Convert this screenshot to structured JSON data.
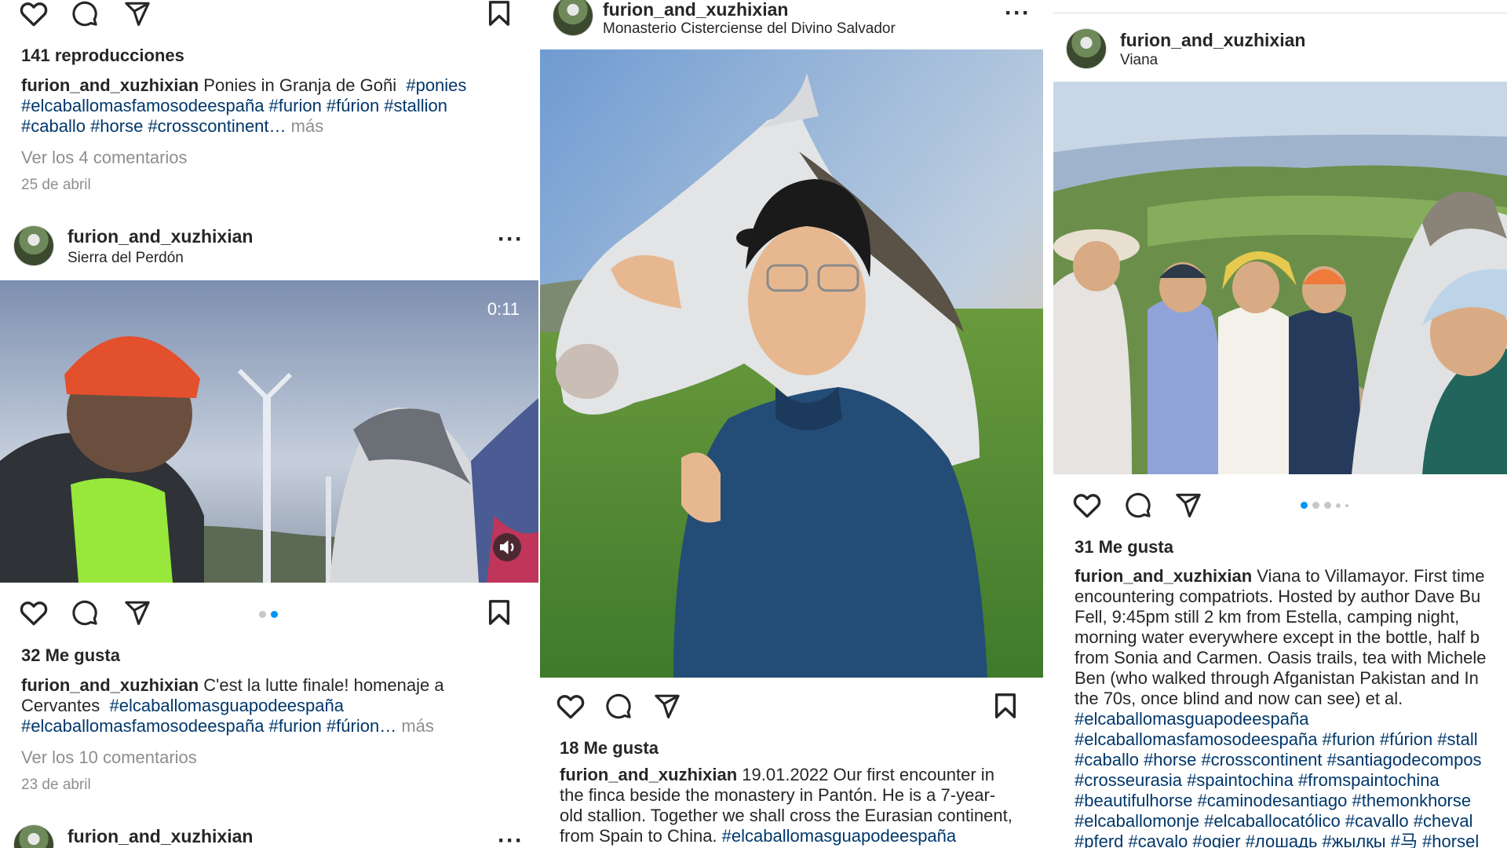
{
  "post1": {
    "views": "141 reproducciones",
    "caption_user": "furion_and_xuzhixian",
    "caption_text": "Ponies in Granja de Goñi",
    "tags_line1": "#ponies",
    "tags_line2": "#elcaballomasfamosodeespaña #furion #fúrion #stallion",
    "tags_line3": "#caballo #horse #crosscontinent…",
    "more": "más",
    "view_comments": "Ver los 4 comentarios",
    "date": "25 de abril"
  },
  "post2": {
    "username": "furion_and_xuzhixian",
    "location": "Sierra del Perdón",
    "video_time": "0:11",
    "likes": "32 Me gusta",
    "caption_user": "furion_and_xuzhixian",
    "caption_text": "C'est la lutte finale! homenaje a",
    "caption_line2_text": "Cervantes",
    "caption_line2_tag": "#elcaballomasguapodeespaña",
    "caption_line3_tags": "#elcaballomasfamosodeespaña #furion #fúrion…",
    "more": "más",
    "view_comments": "Ver los 10 comentarios",
    "date": "23 de abril"
  },
  "post3": {
    "username": "furion_and_xuzhixian"
  },
  "post4": {
    "username": "furion_and_xuzhixian",
    "location": "Monasterio Cisterciense del Divino Salvador",
    "likes": "18 Me gusta",
    "caption_user": "furion_and_xuzhixian",
    "caption_line1": "19.01.2022 Our first encounter in",
    "caption_line2": "the finca beside the monastery in Pantón. He is a 7-year-",
    "caption_line3": "old stallion. Together we shall cross the Eurasian continent,",
    "caption_line4_text": "from Spain to China.",
    "caption_line4_tag": "#elcaballomasguapodeespaña"
  },
  "post5": {
    "username": "furion_and_xuzhixian",
    "location": "Viana",
    "likes": "31 Me gusta",
    "caption_user": "furion_and_xuzhixian",
    "lines": [
      "Viana to Villamayor. First time",
      "encountering compatriots. Hosted by author Dave Bu",
      "Fell, 9:45pm still 2 km from Estella, camping night,",
      "morning water everywhere except in the bottle, half b",
      "from Sonia and Carmen. Oasis trails, tea with Michele",
      "Ben (who walked through Afganistan Pakistan and In",
      "the 70s, once blind and now can see) et al."
    ],
    "tags": [
      "#elcaballomasguapodeespaña",
      "#elcaballomasfamosodeespaña #furion #fúrion #stall",
      "#caballo #horse #crosscontinent #santiagodecompos",
      "#crosseurasia #spaintochina #fromspaintochina",
      "#beautifulhorse #caminodesantiago #themonkhorse",
      "#elcaballomonje #elcaballocatólico #cavallo #cheval",
      "#pferd #cavalo #ogier #лошадь #жылқы #马 #horsel"
    ]
  }
}
